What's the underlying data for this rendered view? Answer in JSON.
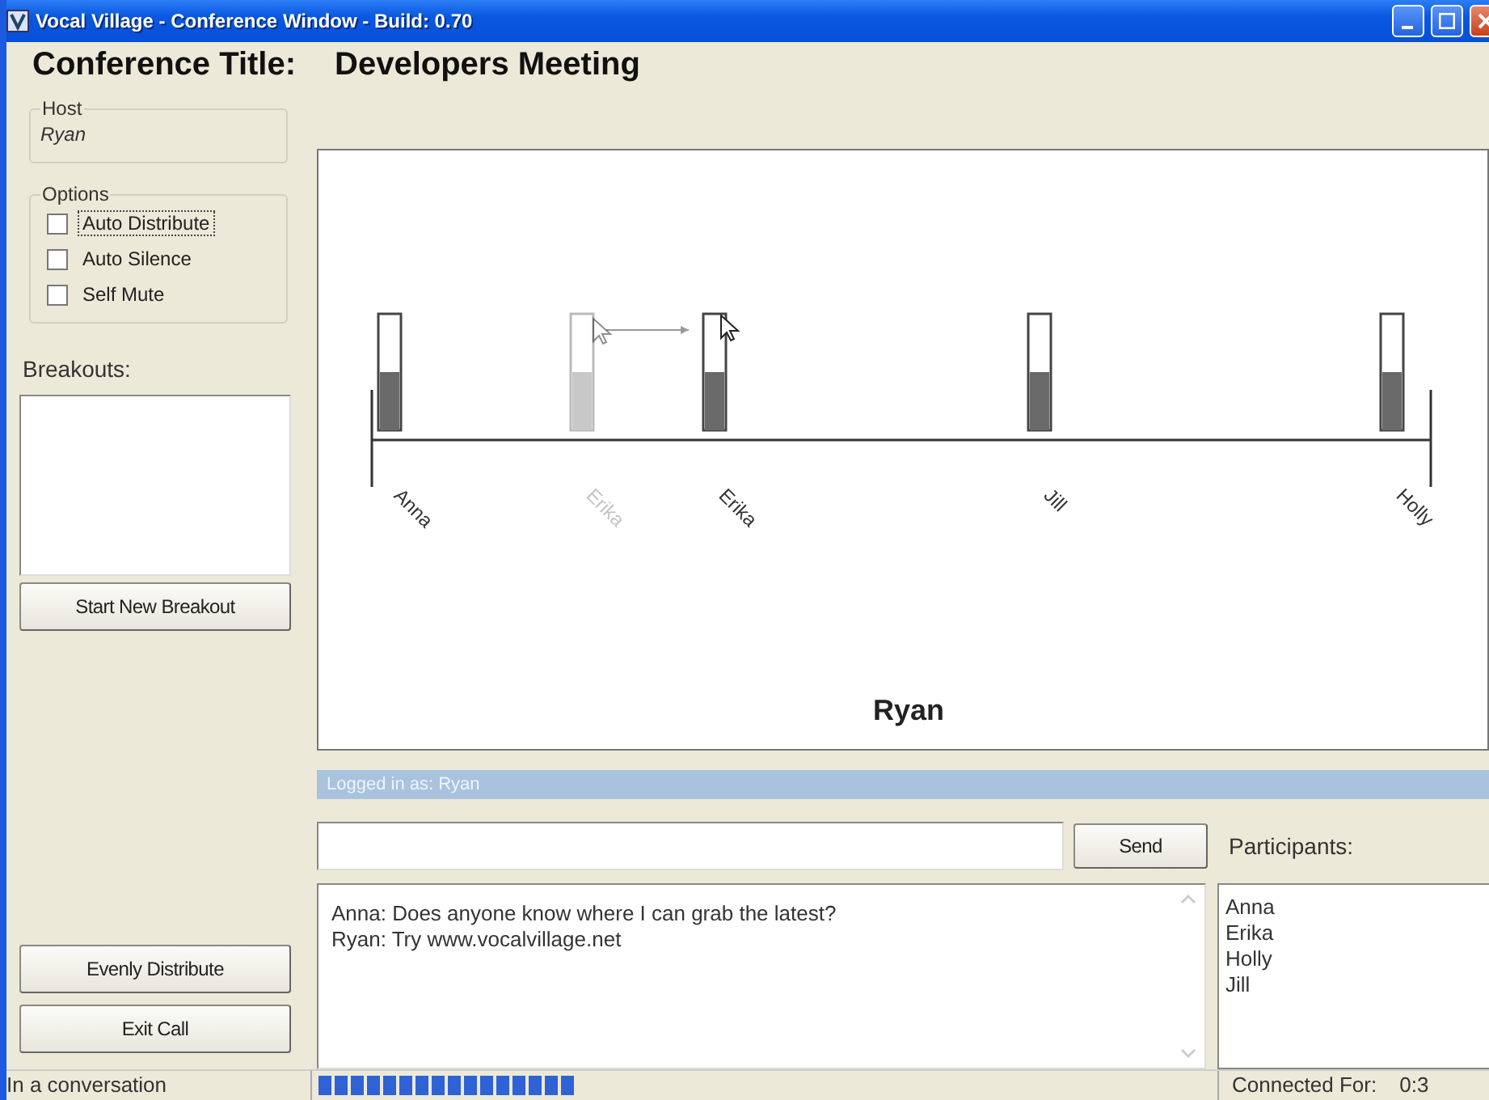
{
  "window": {
    "title": "Vocal Village - Conference Window - Build: 0.70"
  },
  "conference": {
    "label": "Conference Title:",
    "title": "Developers Meeting"
  },
  "host": {
    "label": "Host",
    "name": "Ryan"
  },
  "options": {
    "label": "Options",
    "items": [
      {
        "label": "Auto Distribute",
        "checked": false,
        "focused": true
      },
      {
        "label": "Auto Silence",
        "checked": false,
        "focused": false
      },
      {
        "label": "Self Mute",
        "checked": false,
        "focused": false
      }
    ]
  },
  "breakouts": {
    "label": "Breakouts:",
    "button": "Start New Breakout"
  },
  "call_buttons": [
    "Evenly Distribute",
    "Exit Call"
  ],
  "stage": {
    "participants": [
      {
        "name": "Anna",
        "kind": "member",
        "level": 0.5
      },
      {
        "name": "Erika",
        "kind": "ghost",
        "level": 0.5
      },
      {
        "name": "Erika",
        "kind": "member",
        "level": 0.5
      },
      {
        "name": "Jill",
        "kind": "member",
        "level": 0.5
      },
      {
        "name": "Holly",
        "kind": "member",
        "level": 0.5
      }
    ],
    "speaker": "Ryan"
  },
  "login_bar": "Logged in as: Ryan",
  "chat": {
    "send": "Send",
    "messages": [
      "Anna: Does anyone know where I can grab the latest?",
      "Ryan: Try www.vocalvillage.net"
    ]
  },
  "participants": {
    "label": "Participants:",
    "names": [
      "Anna",
      "Erika",
      "Holly",
      "Jill"
    ]
  },
  "status_bar": {
    "state": "In a conversation",
    "progress": {
      "level": 0.29
    },
    "connected_label": "Connected For:",
    "connected_time": "0:3"
  }
}
